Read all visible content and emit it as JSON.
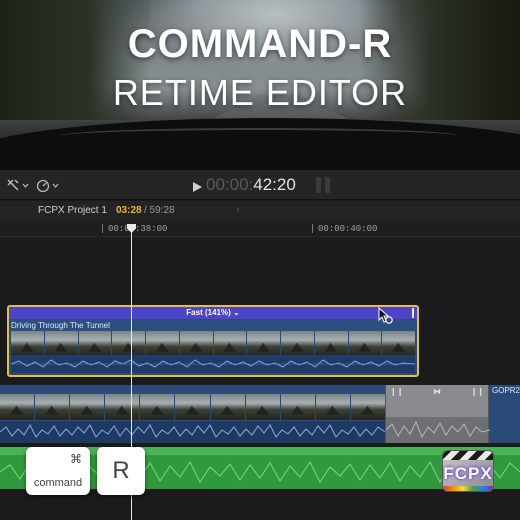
{
  "hero": {
    "title": "COMMAND-R",
    "subtitle": "RETIME EDITOR"
  },
  "toolbar": {
    "tools_icon": "select-tool-icon",
    "retime_icon": "speedometer-icon",
    "timecode_dim": "00:00:",
    "timecode_bright": "42:20"
  },
  "project": {
    "name": "FCPX Project 1",
    "current_time": "03:28",
    "duration": "/ 59:28"
  },
  "ruler": {
    "label_1": "00:00:38:00",
    "label_2": "00:00:40:00"
  },
  "selected_clip": {
    "speed_label": "Fast (141%) ⌄",
    "speed_percent": 141,
    "name": "Driving Through The Tunnel"
  },
  "storyline": {
    "next_clip_name": "GOPR2"
  },
  "keys": {
    "command_symbol": "⌘",
    "command_label": "command",
    "r_label": "R"
  },
  "logo": {
    "text": "FCPX"
  },
  "colors": {
    "accent_yellow": "#e2c23a",
    "retime_purple": "#4d44c9",
    "clip_blue": "#2a4a78",
    "audio_green": "#2f9a3b",
    "timecode_orange": "#e6b923"
  }
}
